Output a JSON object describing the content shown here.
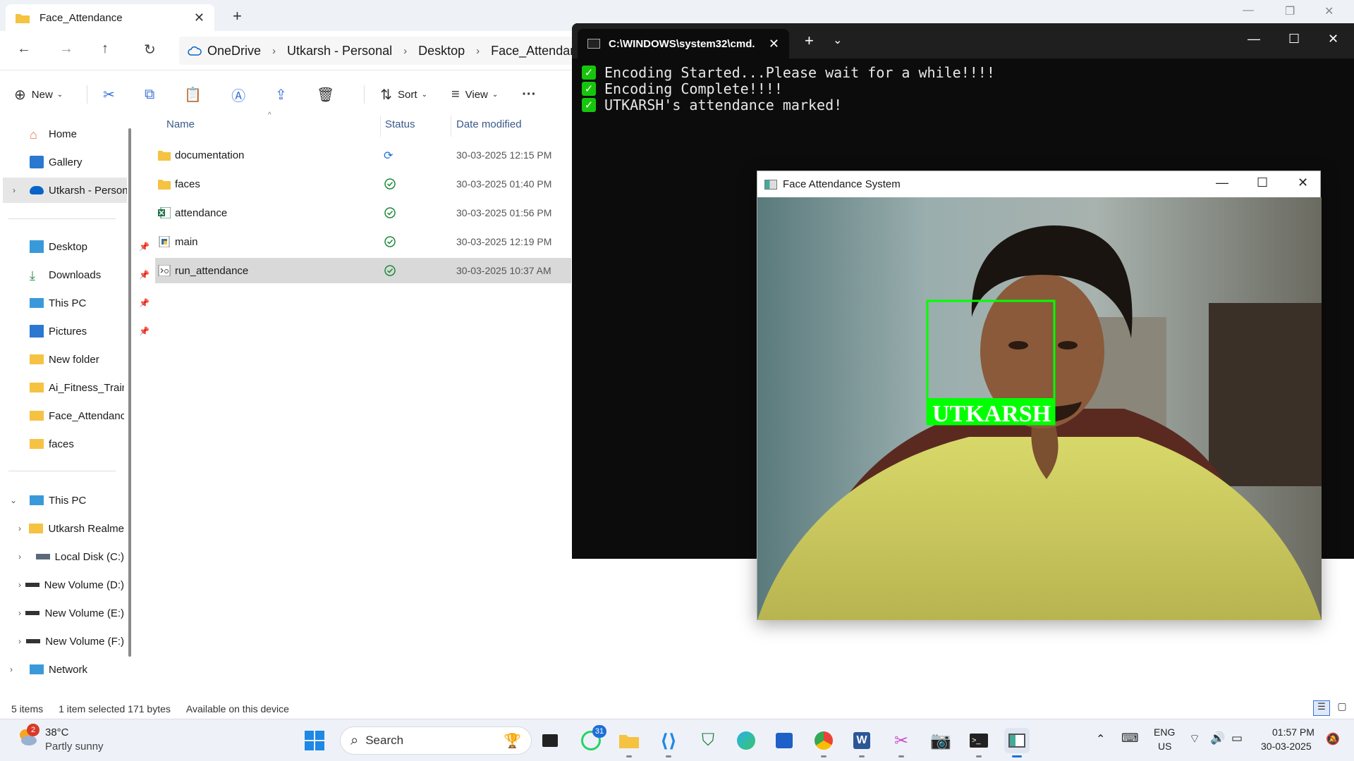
{
  "explorer": {
    "tab_title": "Face_Attendance",
    "new_tab": "+",
    "breadcrumb": [
      "OneDrive",
      "Utkarsh - Personal",
      "Desktop",
      "Face_Attendance"
    ],
    "commands": {
      "new": "New",
      "sort": "Sort",
      "view": "View",
      "more": "···"
    },
    "nav": {
      "home": "Home",
      "gallery": "Gallery",
      "onedrive": "Utkarsh - Personal",
      "desktop": "Desktop",
      "downloads": "Downloads",
      "thispc_pin": "This PC",
      "pictures": "Pictures",
      "new_folder": "New folder",
      "ai_fitness": "Ai_Fitness_Trainer",
      "face_attendance": "Face_Attendance",
      "faces": "faces",
      "thispc": "This PC",
      "realm": "Utkarsh Realme",
      "local_disk": "Local Disk (C:)",
      "vol1": "New Volume (D:)",
      "vol2": "New Volume (E:)",
      "vol3": "New Volume (F:)",
      "network": "Network"
    },
    "columns": {
      "name": "Name",
      "status": "Status",
      "date": "Date modified"
    },
    "files": [
      {
        "name": "documentation",
        "type": "folder",
        "status": "syncing",
        "date": "30-03-2025 12:15 PM"
      },
      {
        "name": "faces",
        "type": "folder",
        "status": "available",
        "date": "30-03-2025 01:40 PM"
      },
      {
        "name": "attendance",
        "type": "excel",
        "status": "available",
        "date": "30-03-2025 01:56 PM"
      },
      {
        "name": "main",
        "type": "python",
        "status": "available",
        "date": "30-03-2025 12:19 PM"
      },
      {
        "name": "run_attendance",
        "type": "batch",
        "status": "available",
        "date": "30-03-2025 10:37 AM"
      }
    ],
    "status": {
      "count": "5 items",
      "selected": "1 item selected  171 bytes",
      "availability": "Available on this device"
    }
  },
  "cmd": {
    "tab_title": "C:\\WINDOWS\\system32\\cmd.",
    "lines": [
      "Encoding Started...Please wait for a while!!!!",
      "Encoding Complete!!!!",
      "UTKARSH's attendance marked!"
    ]
  },
  "camera": {
    "title": "Face Attendance System",
    "face_label": "UTKARSH",
    "box_color": "#00ff00"
  },
  "taskbar": {
    "weather_temp": "38°C",
    "weather_desc": "Partly sunny",
    "weather_badge": "2",
    "search_placeholder": "Search",
    "whatsapp_badge": "31",
    "lang": "ENG",
    "region": "US",
    "time": "01:57 PM",
    "date": "30-03-2025"
  }
}
